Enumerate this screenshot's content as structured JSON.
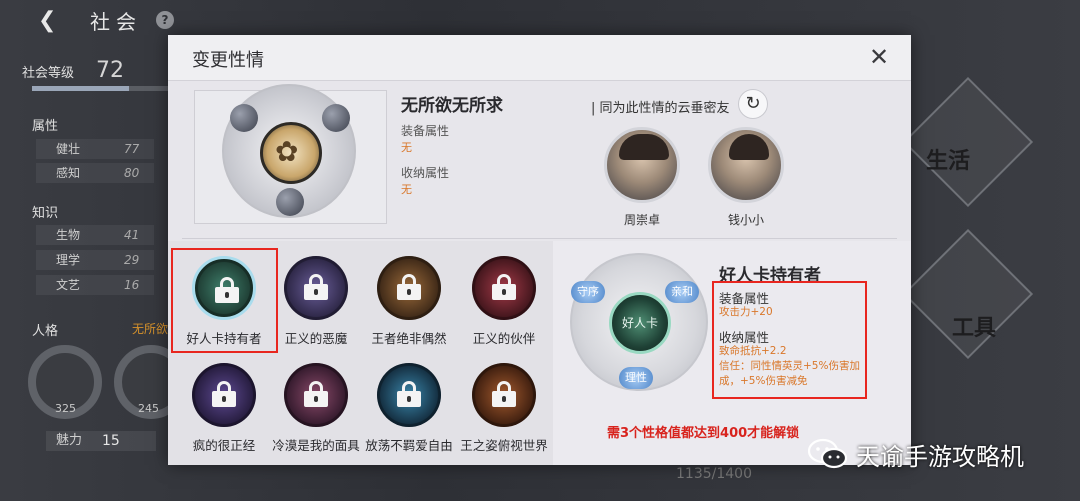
{
  "background": {
    "title": "社会",
    "help": "?",
    "level_label": "社会等级",
    "level_value": "72",
    "attr_section": "属性",
    "attrs": [
      {
        "name": "健壮",
        "value": "77"
      },
      {
        "name": "感知",
        "value": "80"
      }
    ],
    "knowledge_section": "知识",
    "knowledge": [
      {
        "name": "生物",
        "value": "41"
      },
      {
        "name": "理学",
        "value": "29"
      },
      {
        "name": "文艺",
        "value": "16"
      }
    ],
    "personality_section": "人格",
    "personality_hint": "无所欲",
    "ring_values": [
      "325",
      "245"
    ],
    "charm_label": "魅力",
    "charm_value": "15",
    "tile_life": "生活",
    "tile_tools": "工具",
    "bottom_value": "1135/1400"
  },
  "modal": {
    "title": "变更性情",
    "close_icon": "close-icon",
    "current": {
      "name": "无所欲无所求",
      "equip_label": "装备属性",
      "equip_value": "无",
      "store_label": "收纳属性",
      "store_value": "无"
    },
    "friends_label": "| 同为此性情的云垂密友",
    "refresh_icon": "refresh-icon",
    "friends": [
      {
        "name": "周崇卓"
      },
      {
        "name": "钱小小"
      }
    ],
    "personalities": [
      {
        "label": "好人卡持有者",
        "color": "#2f6b5a",
        "selected": true
      },
      {
        "label": "正义的恶魔",
        "color": "#4a3f6e",
        "selected": false
      },
      {
        "label": "王者绝非偶然",
        "color": "#6b4a2a",
        "selected": false
      },
      {
        "label": "正义的伙伴",
        "color": "#6e2a34",
        "selected": false
      },
      {
        "label": "疯的很正经",
        "color": "#3c2c5e",
        "selected": false
      },
      {
        "label": "冷漠是我的面具",
        "color": "#5c2f46",
        "selected": false
      },
      {
        "label": "放荡不羁爱自由",
        "color": "#2a5a7a",
        "selected": false
      },
      {
        "label": "王之姿俯视世界",
        "color": "#6b3a22",
        "selected": false
      }
    ],
    "detail": {
      "emblem_text": "好人卡",
      "tags": [
        "守序",
        "亲和",
        "理性"
      ],
      "name": "好人卡持有者",
      "equip_label": "装备属性",
      "equip_value": "攻击力+20",
      "store_label": "收纳属性",
      "store_value_1": "致命抵抗+2.2",
      "store_value_2": "信任：同性情英灵+5%伤害加成，+5%伤害减免"
    },
    "unlock_note": "需3个性格值都达到400才能解锁"
  },
  "watermark": {
    "text": "天谕手游攻略机",
    "icon": "wechat-icon"
  },
  "colors": {
    "accent_red": "#e8261f",
    "value_orange": "#d9772a",
    "modal_bg": "#e7e6eb"
  }
}
